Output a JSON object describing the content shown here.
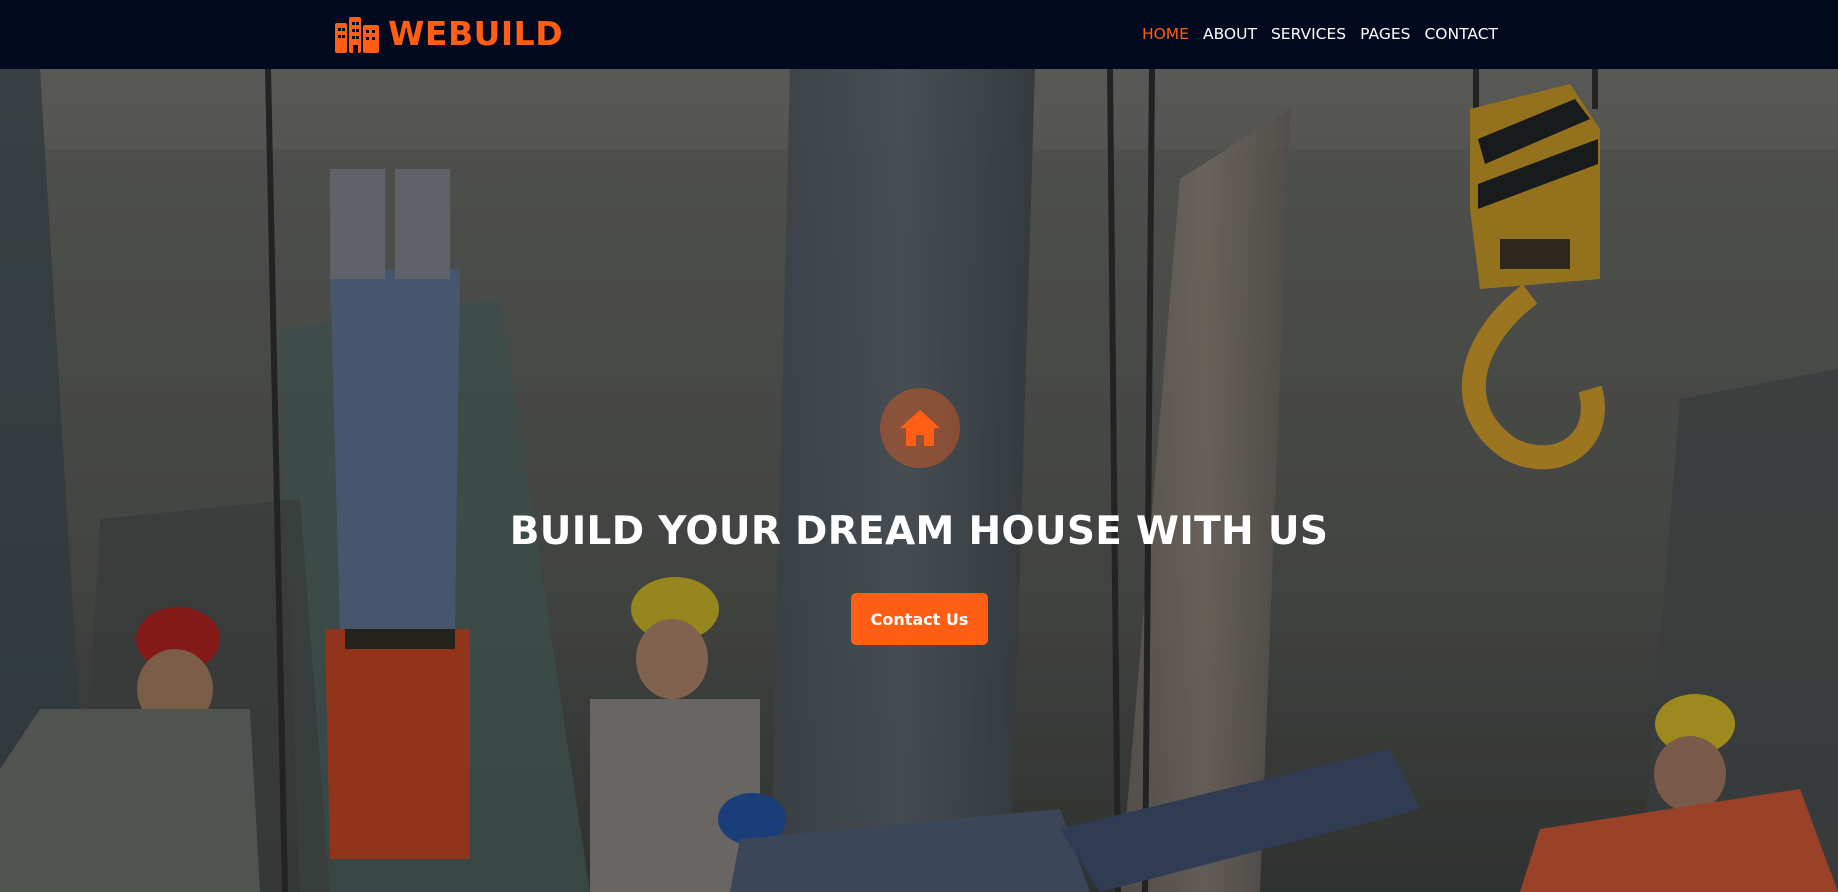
{
  "brand": {
    "name": "WEBUILD",
    "icon": "building-icon",
    "color": "#ff5e14"
  },
  "nav": {
    "items": [
      {
        "label": "HOME",
        "active": true
      },
      {
        "label": "ABOUT",
        "active": false
      },
      {
        "label": "SERVICES",
        "active": false
      },
      {
        "label": "PAGES",
        "active": false
      },
      {
        "label": "CONTACT",
        "active": false
      }
    ]
  },
  "hero": {
    "badge_icon": "home-icon",
    "title": "BUILD YOUR DREAM HOUSE WITH US",
    "cta_label": "Contact Us",
    "background": "construction-workers-over-city-photo"
  },
  "colors": {
    "accent": "#ff5e14",
    "navbar_bg": "#03091e",
    "text": "#ffffff"
  }
}
